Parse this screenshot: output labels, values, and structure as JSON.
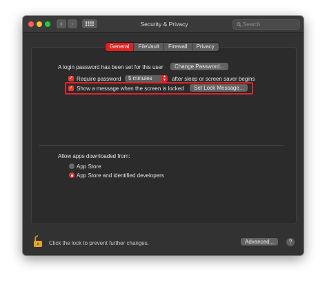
{
  "window": {
    "title": "Security & Privacy",
    "back_icon": "‹",
    "forward_icon": "›"
  },
  "search": {
    "placeholder": "Search"
  },
  "tabs": [
    {
      "label": "General",
      "active": true
    },
    {
      "label": "FileVault",
      "active": false
    },
    {
      "label": "Firewall",
      "active": false
    },
    {
      "label": "Privacy",
      "active": false
    }
  ],
  "general": {
    "login_password_text": "A login password has been set for this user",
    "change_password_button": "Change Password...",
    "require_password": {
      "label": "Require password",
      "checked": true,
      "delay_value": "5 minutes",
      "suffix": "after sleep or screen saver begins"
    },
    "show_message": {
      "label": "Show a message when the screen is locked",
      "checked": true,
      "button": "Set Lock Message..."
    },
    "allow_apps": {
      "label": "Allow apps downloaded from:",
      "options": [
        {
          "label": "App Store",
          "selected": false
        },
        {
          "label": "App Store and identified developers",
          "selected": true
        }
      ]
    }
  },
  "footer": {
    "lock_text": "Click the lock to prevent further changes.",
    "advanced_button": "Advanced...",
    "help_label": "?"
  },
  "colors": {
    "accent": "#e02020",
    "highlight_box": "#e0242c",
    "window_bg": "#323232"
  }
}
